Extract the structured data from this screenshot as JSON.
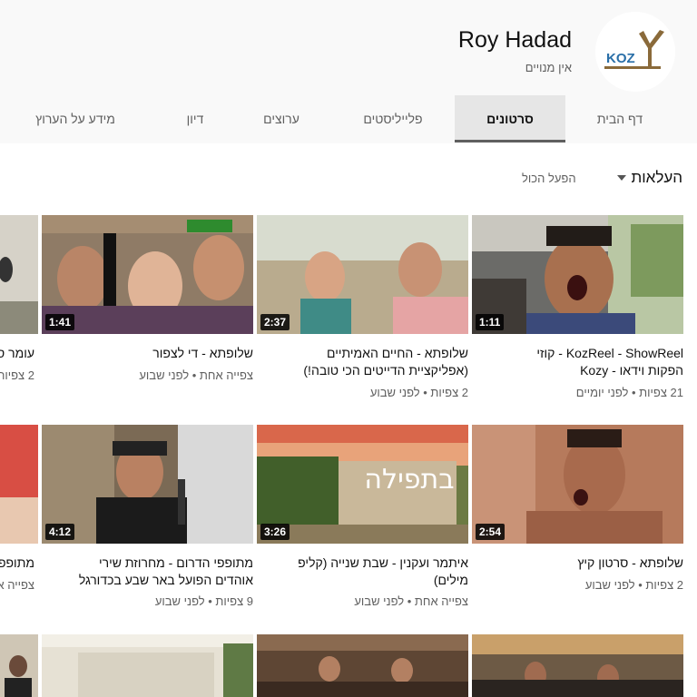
{
  "channel": {
    "name": "Roy Hadad",
    "subscribers": "אין מנויים",
    "logo_text": "KOZ"
  },
  "tabs": [
    {
      "label": "דף הבית"
    },
    {
      "label": "סרטונים"
    },
    {
      "label": "פלייליסטים"
    },
    {
      "label": "ערוצים"
    },
    {
      "label": "דיון"
    },
    {
      "label": "מידע על הערוץ"
    }
  ],
  "sort": {
    "label": "העלאות",
    "play_all": "הפעל הכול"
  },
  "videos_row1": [
    {
      "title": "KozReel - ShowReel - קוזי\nהפקות וידאו - Kozy",
      "meta": "21 צפיות • לפני יומיים",
      "duration": "1:11"
    },
    {
      "title": "שלופתא - החיים האמיתיים\n(אפליקציית הדייטים הכי טובה!)",
      "meta": "2 צפיות • לפני שבוע",
      "duration": "2:37"
    },
    {
      "title": "שלופתא - די לצפור",
      "meta": "צפייה אחת • לפני שבוע",
      "duration": "1:41"
    },
    {
      "title": "עומר ס",
      "meta": "2 צפיות",
      "duration": ""
    }
  ],
  "videos_row2": [
    {
      "title": "שלופתא - סרטון קיץ",
      "meta": "2 צפיות • לפני שבוע",
      "duration": "2:54"
    },
    {
      "title": "איתמר ועקנין - שבת שנייה (קליפ\nמילים)",
      "meta": "צפייה אחת • לפני שבוע",
      "duration": "3:26",
      "overlay": "בתפילה"
    },
    {
      "title": "מתופפי הדרום - מחרוזת שירי\nאוהדים הפועל באר שבע בכדורגל",
      "meta": "9 צפיות • לפני שבוע",
      "duration": "4:12"
    },
    {
      "title": "מתופפ",
      "meta": "צפייה א",
      "duration": ""
    }
  ],
  "colors": {
    "accent": "#606060",
    "header_bg": "#f9f9f9",
    "tab_active_bg": "#e6e6e6"
  }
}
